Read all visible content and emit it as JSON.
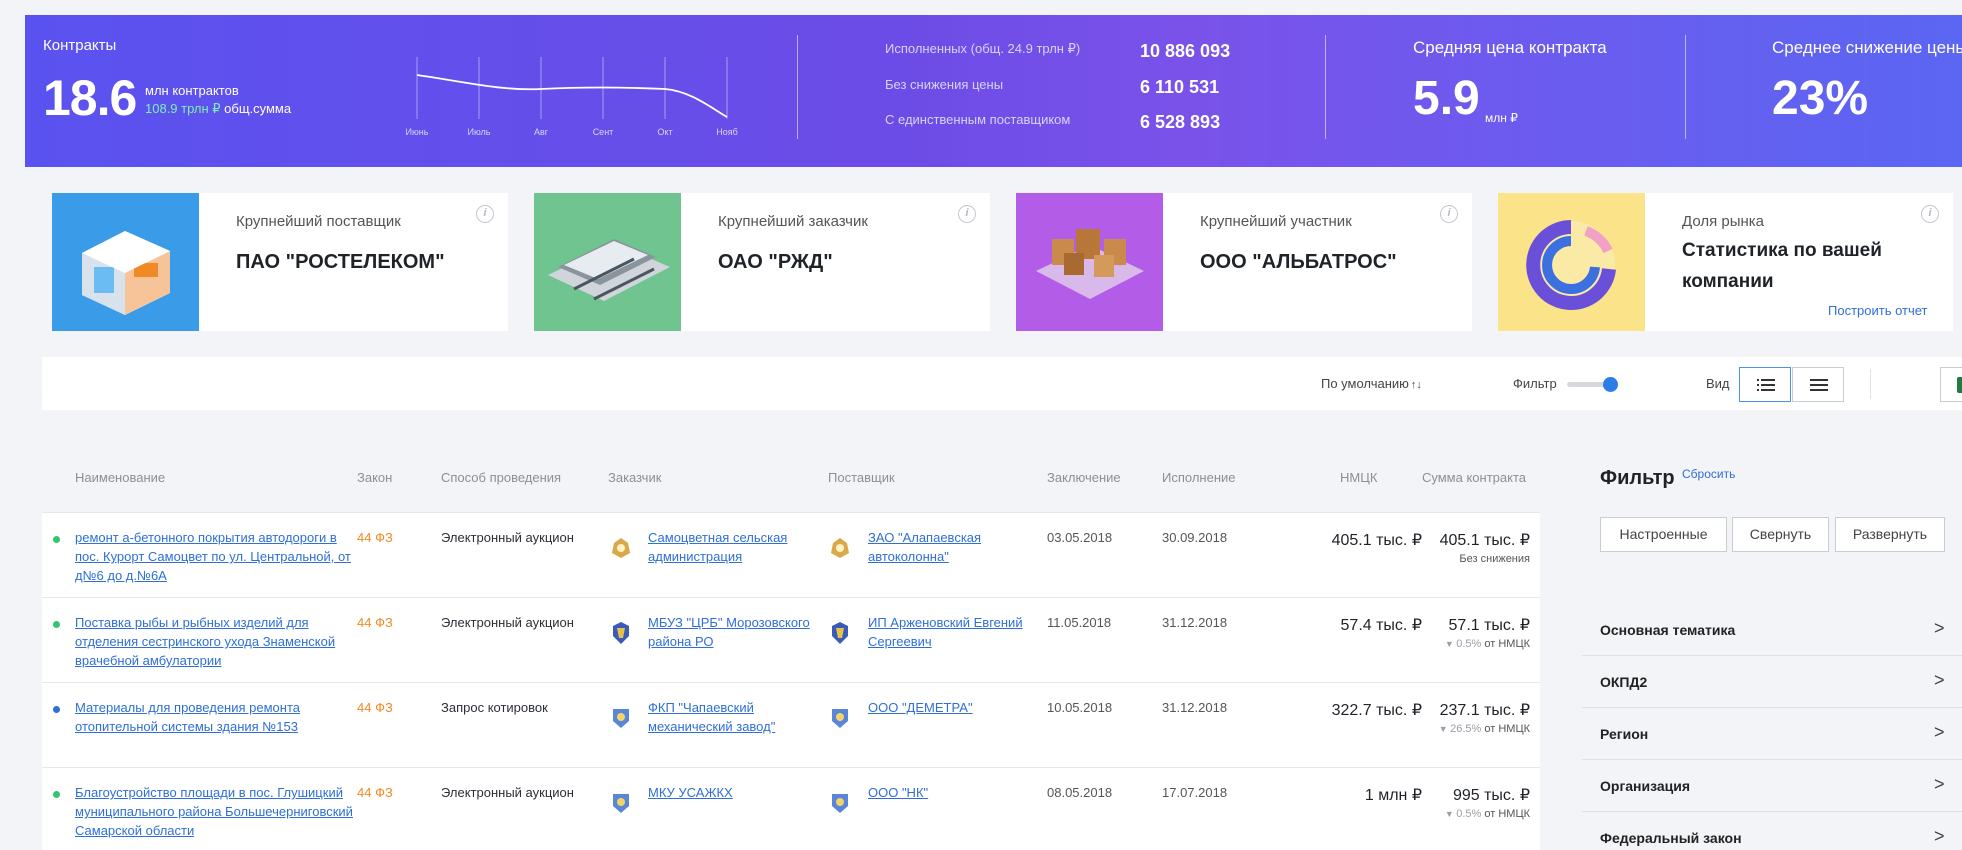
{
  "header": {
    "contracts_label": "Контракты",
    "contracts_count": "18.6",
    "contracts_unit": "млн контрактов",
    "contracts_sum": "108.9 трлн ₽",
    "contracts_sum_suffix": "общ.сумма",
    "spark_months": [
      "Июнь",
      "Июль",
      "Авг",
      "Сент",
      "Окт",
      "Нояб"
    ],
    "stats": [
      {
        "label": "Исполненных (общ. 24.9 трлн ₽)",
        "value": "10 886 093"
      },
      {
        "label": "Без снижения цены",
        "value": "6 110 531"
      },
      {
        "label": "С единственным поставщиком",
        "value": "6 528 893"
      }
    ],
    "avg_price_label": "Средняя цена контракта",
    "avg_price_value": "5.9",
    "avg_price_unit": "млн ₽",
    "avg_drop_label": "Среднее снижение цены",
    "avg_drop_value": "23%"
  },
  "cards": [
    {
      "title": "Крупнейший поставщик",
      "value": "ПАО \"РОСТЕЛЕКОМ\""
    },
    {
      "title": "Крупнейший заказчик",
      "value": "ОАО \"РЖД\""
    },
    {
      "title": "Крупнейший участник",
      "value": "ООО \"АЛЬБАТРОС\""
    },
    {
      "title": "Доля рынка",
      "value": "Статистика по вашей компании",
      "link": "Построить отчет"
    }
  ],
  "info_glyph": "i",
  "toolbar": {
    "sort_label": "По умолчанию",
    "sort_icon": "↑↓",
    "filter_label": "Фильтр",
    "view_label": "Вид",
    "excel_glyph": "x"
  },
  "table": {
    "headers": [
      "Наименование",
      "Закон",
      "Способ проведения",
      "Заказчик",
      "Поставщик",
      "Заключение",
      "Исполнение",
      "НМЦК",
      "Сумма контракта"
    ],
    "rows": [
      {
        "status_color": "#2ec770",
        "name": "ремонт а-бетонного покрытия автодороги в пос. Курорт Самоцвет по ул. Центральной, от д№6 до д.№6А",
        "law": "44 ФЗ",
        "method": "Электронный аукцион",
        "customer": "Самоцветная сельская администрация",
        "supplier": "ЗАО \"Алапаевская автоколонна\"",
        "signed": "03.05.2018",
        "executed": "30.09.2018",
        "nmck": "405.1 тыс. ₽",
        "sum": "405.1 тыс. ₽",
        "sub": "Без снижения",
        "pct": ""
      },
      {
        "status_color": "#2ec770",
        "name": "Поставка рыбы и рыбных изделий для отделения сестринского ухода Знаменской врачебной амбулатории",
        "law": "44 ФЗ",
        "method": "Электронный аукцион",
        "customer": "МБУЗ \"ЦРБ\" Морозовского района РО",
        "supplier": "ИП Арженовский Евгений Сергеевич",
        "signed": "11.05.2018",
        "executed": "31.12.2018",
        "nmck": "57.4 тыс. ₽",
        "sum": "57.1 тыс. ₽",
        "sub": "от НМЦК",
        "pct": "0.5%"
      },
      {
        "status_color": "#2f6fd6",
        "name": "Материалы для проведения ремонта отопительной системы здания №153",
        "law": "44 ФЗ",
        "method": "Запрос котировок",
        "customer": "ФКП \"Чапаевский механический завод\"",
        "supplier": "ООО \"ДЕМЕТРА\"",
        "signed": "10.05.2018",
        "executed": "31.12.2018",
        "nmck": "322.7 тыс. ₽",
        "sum": "237.1 тыс. ₽",
        "sub": "от НМЦК",
        "pct": "26.5%"
      },
      {
        "status_color": "#2ec770",
        "name": "Благоустройство площади в пос. Глушицкий муниципального района Большечерниговский Самарской области",
        "law": "44 ФЗ",
        "method": "Электронный аукцион",
        "customer": "МКУ УСАЖКХ",
        "supplier": "ООО \"НК\"",
        "signed": "08.05.2018",
        "executed": "17.07.2018",
        "nmck": "1 млн ₽",
        "sum": "995 тыс. ₽",
        "sub": "от НМЦК",
        "pct": "0.5%"
      }
    ]
  },
  "filter": {
    "title": "Фильтр",
    "reset": "Сбросить",
    "buttons": [
      "Настроенные",
      "Свернуть",
      "Развернуть"
    ],
    "items": [
      "Основная тематика",
      "ОКПД2",
      "Регион",
      "Организация",
      "Федеральный закон"
    ],
    "chevron": ">"
  }
}
